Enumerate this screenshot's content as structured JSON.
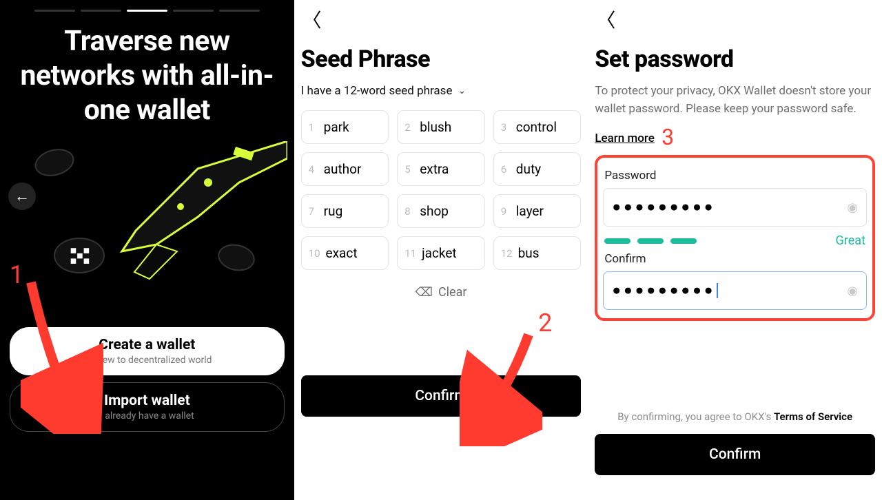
{
  "panel1": {
    "headline": "Traverse new networks with all-in-one wallet",
    "create_title": "Create a wallet",
    "create_sub": "I'm new to decentralized world",
    "import_title": "Import wallet",
    "import_sub": "I already have a wallet"
  },
  "panel2": {
    "title": "Seed Phrase",
    "selector": "I have a 12-word seed phrase",
    "words": [
      "park",
      "blush",
      "control",
      "author",
      "extra",
      "duty",
      "rug",
      "shop",
      "layer",
      "exact",
      "jacket",
      "bus"
    ],
    "clear": "Clear",
    "confirm": "Confirm"
  },
  "panel3": {
    "title": "Set password",
    "desc_a": "To protect your privacy, OKX Wallet doesn't store your wallet password. Please keep your password safe. ",
    "learn_more": "Learn more",
    "password_label": "Password",
    "password_value": "●●●●●●●●●",
    "confirm_label": "Confirm",
    "confirm_value": "●●●●●●●●●",
    "strength_label": "Great",
    "tos_prefix": "By confirming, you agree to OKX's ",
    "tos_link": "Terms of Service",
    "confirm_btn": "Confirm"
  },
  "annotations": {
    "n1": "1",
    "n2": "2",
    "n3": "3"
  }
}
